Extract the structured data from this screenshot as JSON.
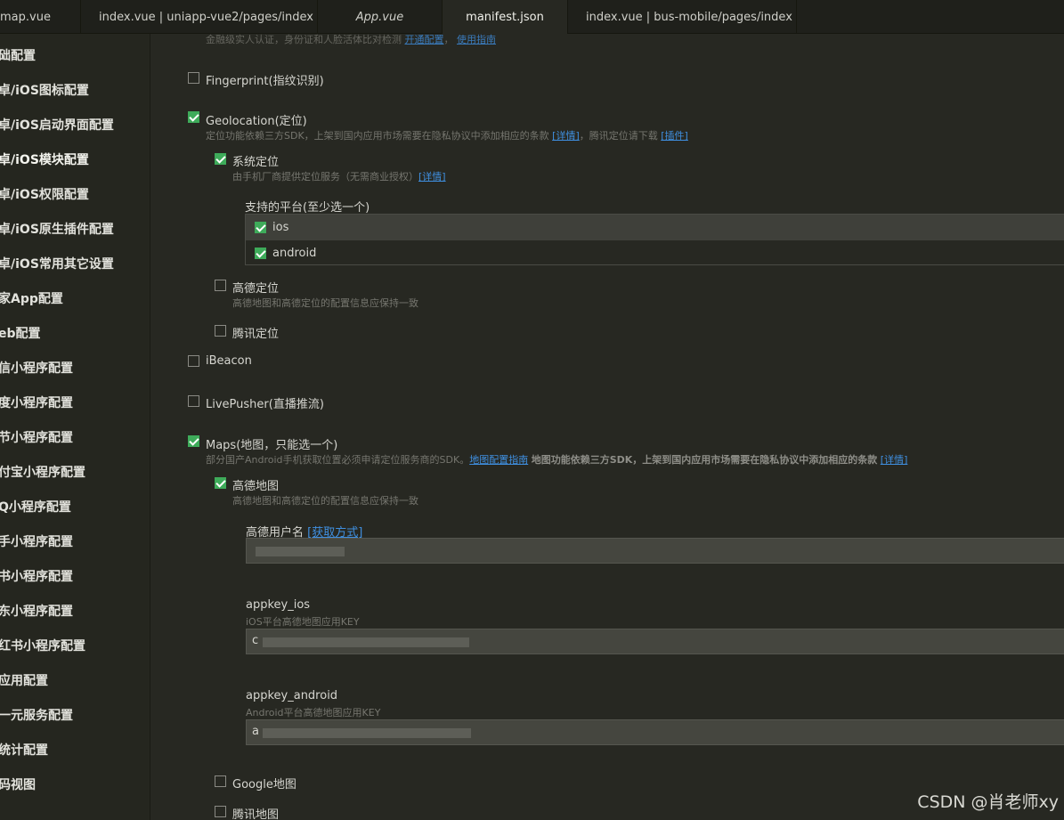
{
  "tabs": [
    {
      "label": "map.vue"
    },
    {
      "label": "index.vue | uniapp-vue2/pages/index"
    },
    {
      "label": "App.vue"
    },
    {
      "label": "manifest.json"
    },
    {
      "label": "index.vue | bus-mobile/pages/index"
    }
  ],
  "sidebar": {
    "items": [
      {
        "label": "础配置"
      },
      {
        "label": "卓/iOS图标配置"
      },
      {
        "label": "卓/iOS启动界面配置"
      },
      {
        "label": "卓/iOS模块配置"
      },
      {
        "label": "卓/iOS权限配置"
      },
      {
        "label": "卓/iOS原生插件配置"
      },
      {
        "label": "卓/iOS常用其它设置"
      },
      {
        "label": "家App配置"
      },
      {
        "label": "eb配置"
      },
      {
        "label": "信小程序配置"
      },
      {
        "label": "度小程序配置"
      },
      {
        "label": "节小程序配置"
      },
      {
        "label": "付宝小程序配置"
      },
      {
        "label": "Q小程序配置"
      },
      {
        "label": "手小程序配置"
      },
      {
        "label": "书小程序配置"
      },
      {
        "label": "东小程序配置"
      },
      {
        "label": "红书小程序配置"
      },
      {
        "label": "应用配置"
      },
      {
        "label": "一元服务配置"
      },
      {
        "label": "统计配置"
      },
      {
        "label": "码视图"
      }
    ]
  },
  "content": {
    "top_desc_partial": "金融级实人认证，身份证和人脸活体比对检测",
    "top_link1": "开通配置",
    "top_link2": "使用指南",
    "fingerprint": {
      "label": "Fingerprint(指纹识别)",
      "checked": false
    },
    "geolocation": {
      "label": "Geolocation(定位)",
      "checked": true,
      "desc": "定位功能依赖三方SDK，上架到国内应用市场需要在隐私协议中添加相应的条款",
      "link_detail": "[详情]",
      "desc2": "，腾讯定位请下载",
      "link_plugin": "[插件]"
    },
    "system_location": {
      "label": "系统定位",
      "checked": true,
      "desc": "由手机厂商提供定位服务（无需商业授权）",
      "link": "[详情]"
    },
    "platforms": {
      "title": "支持的平台(至少选一个)",
      "ios": {
        "label": "ios",
        "checked": true
      },
      "android": {
        "label": "android",
        "checked": true
      }
    },
    "amap_location": {
      "label": "高德定位",
      "checked": false,
      "desc": "高德地图和高德定位的配置信息应保持一致"
    },
    "tencent_location": {
      "label": "腾讯定位",
      "checked": false
    },
    "ibeacon": {
      "label": "iBeacon",
      "checked": false
    },
    "livepusher": {
      "label": "LivePusher(直播推流)",
      "checked": false
    },
    "maps": {
      "label": "Maps(地图，只能选一个)",
      "checked": true,
      "desc": "部分国产Android手机获取位置必须申请定位服务商的SDK。",
      "link_guide": "地图配置指南",
      "desc_bold": "地图功能依赖三方SDK，上架到国内应用市场需要在隐私协议中添加相应的条款",
      "link_detail": "[详情]"
    },
    "amap": {
      "label": "高德地图",
      "checked": true,
      "desc": "高德地图和高德定位的配置信息应保持一致",
      "username_label": "高德用户名",
      "username_link": "[获取方式]",
      "username_value": "",
      "appkey_ios_label": "appkey_ios",
      "appkey_ios_desc": "iOS平台高德地图应用KEY",
      "appkey_ios_value": "c",
      "appkey_android_label": "appkey_android",
      "appkey_android_desc": "Android平台高德地图应用KEY",
      "appkey_android_value": "a"
    },
    "google_map": {
      "label": "Google地图",
      "checked": false
    },
    "tencent_map": {
      "label": "腾讯地图",
      "checked": false
    }
  },
  "watermark": "CSDN @肖老师xy",
  "colors": {
    "check": "#3eab5a",
    "link": "#3f8fe0",
    "background": "#272822"
  }
}
